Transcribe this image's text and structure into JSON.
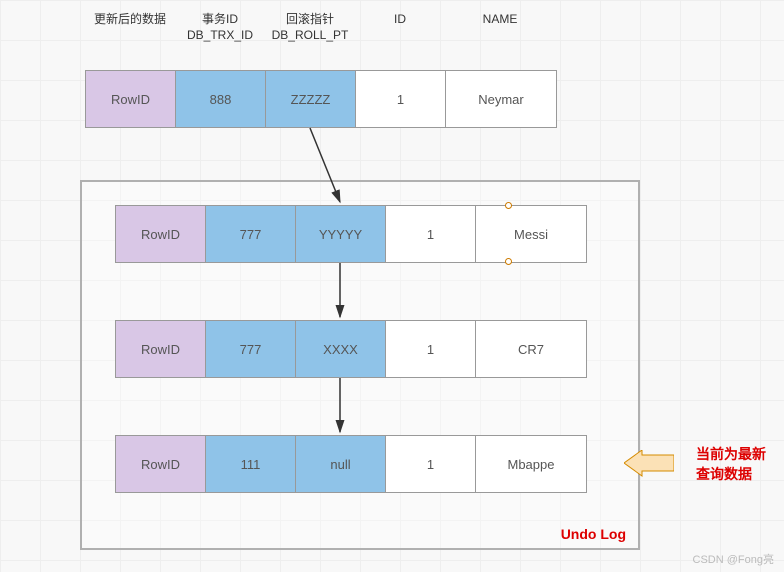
{
  "headers": {
    "col1": {
      "line1": "更新后的数据",
      "line2": ""
    },
    "col2": {
      "line1": "事务ID",
      "line2": "DB_TRX_ID"
    },
    "col3": {
      "line1": "回滚指针",
      "line2": "DB_ROLL_PT"
    },
    "col4": {
      "line1": "ID",
      "line2": ""
    },
    "col5": {
      "line1": "NAME",
      "line2": ""
    }
  },
  "rows": {
    "current": {
      "rowid": "RowID",
      "trx": "888",
      "ptr": "ZZZZZ",
      "id": "1",
      "name": "Neymar"
    },
    "undo1": {
      "rowid": "RowID",
      "trx": "777",
      "ptr": "YYYYY",
      "id": "1",
      "name": "Messi"
    },
    "undo2": {
      "rowid": "RowID",
      "trx": "777",
      "ptr": "XXXX",
      "id": "1",
      "name": "CR7"
    },
    "undo3": {
      "rowid": "RowID",
      "trx": "111",
      "ptr": "null",
      "id": "1",
      "name": "Mbappe"
    }
  },
  "labels": {
    "undo_log": "Undo Log",
    "callout_line1": "当前为最新",
    "callout_line2": "查询数据",
    "watermark": "CSDN @Fong亮"
  },
  "colors": {
    "purple": "#d9c7e6",
    "blue": "#8fc3e8",
    "red": "#d00",
    "arrow_orange": "#f5a623"
  }
}
